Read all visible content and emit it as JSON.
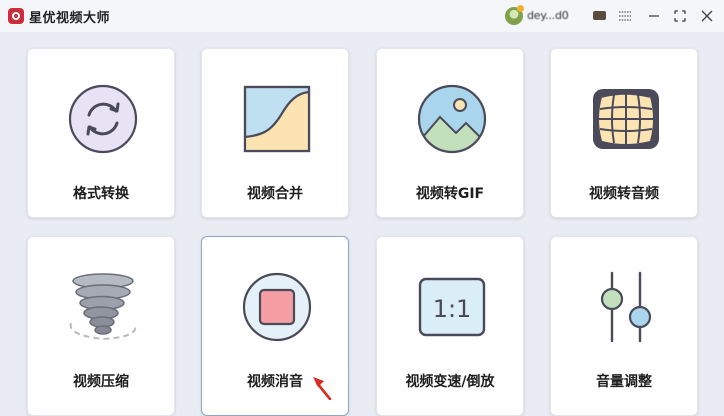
{
  "window": {
    "title": "星优视频大师",
    "username": "dey...d0",
    "buttons": [
      "menu",
      "minimize",
      "maximize",
      "close"
    ]
  },
  "tools": [
    {
      "label": "格式转换",
      "icon": "refresh-circle-icon"
    },
    {
      "label": "视频合并",
      "icon": "merge-curve-icon"
    },
    {
      "label": "视频转GIF",
      "icon": "image-landscape-icon"
    },
    {
      "label": "视频转音频",
      "icon": "audio-globe-icon"
    },
    {
      "label": "视频压缩",
      "icon": "tornado-compress-icon"
    },
    {
      "label": "视频消音",
      "icon": "stop-mute-icon"
    },
    {
      "label": "视频变速/倒放",
      "icon": "ratio-speed-icon"
    },
    {
      "label": "音量调整",
      "icon": "sliders-volume-icon"
    }
  ],
  "colors": {
    "accent_purple": "#e7e2f4",
    "outline": "#4a4a5a",
    "blue": "#a9d6ec",
    "yellow": "#fbe3b2",
    "green": "#c2e0bb",
    "red": "#f59ea3",
    "cursor_red": "#d82d25"
  }
}
